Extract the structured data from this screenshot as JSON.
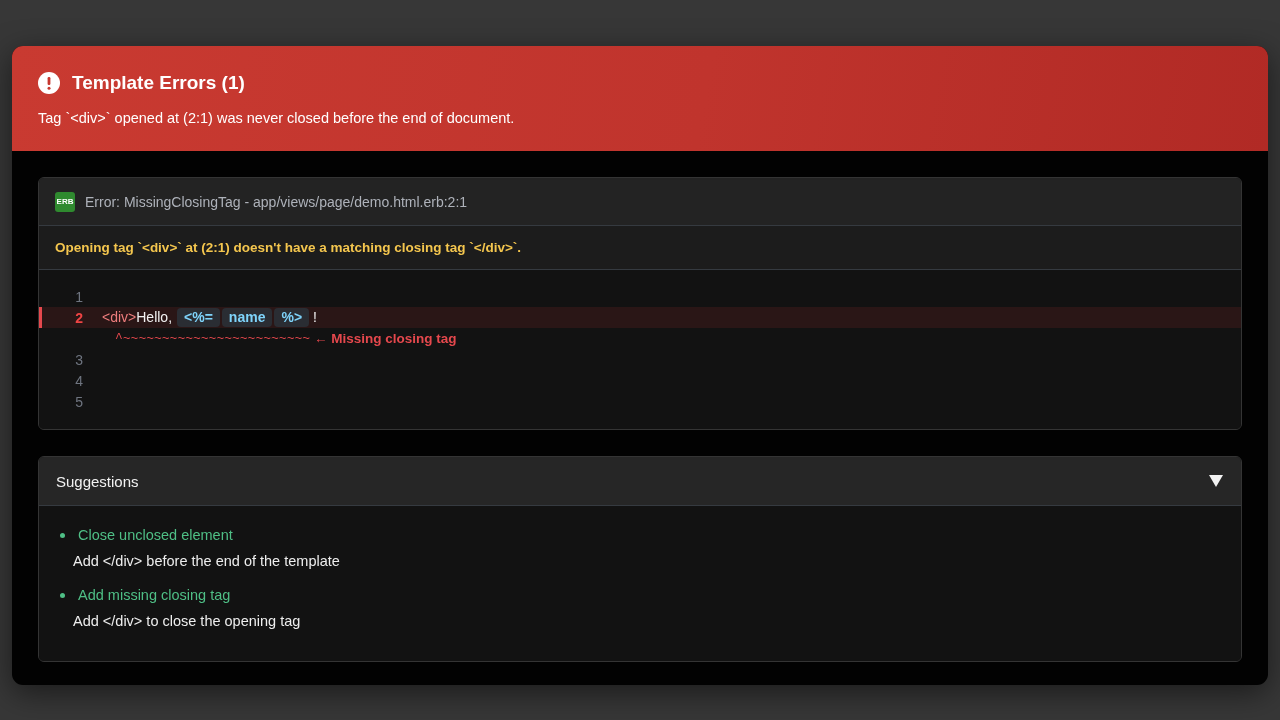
{
  "overlay_header": {
    "title": "Template Errors (1)",
    "message": "Tag `<div>` opened at (2:1) was never closed before the end of document."
  },
  "errors": [
    {
      "badge": "ERB",
      "title": "Error: MissingClosingTag - app/views/page/demo.html.erb:2:1",
      "message": "Opening tag `<div>` at (2:1) doesn't have a matching closing tag `</div>`.",
      "source_lines": [
        {
          "kind": "code",
          "number": "1",
          "highlighted": false
        },
        {
          "kind": "code",
          "number": "2",
          "highlighted": true,
          "tokens": [
            {
              "kind": "tag",
              "text": "<div>"
            },
            {
              "kind": "text",
              "text": "Hello,"
            },
            {
              "kind": "erb",
              "text": "<%="
            },
            {
              "kind": "erb",
              "text": "name"
            },
            {
              "kind": "erb",
              "text": "%>"
            },
            {
              "kind": "text",
              "text": "!"
            }
          ]
        },
        {
          "kind": "pointer",
          "marker": "^~~~~~~~~~~~~~~~~~~~~~~~~",
          "note": "← Missing closing tag"
        },
        {
          "kind": "code",
          "number": "3",
          "highlighted": false
        },
        {
          "kind": "code",
          "number": "4",
          "highlighted": false
        },
        {
          "kind": "code",
          "number": "5",
          "highlighted": false
        }
      ]
    }
  ],
  "suggestions": {
    "title": "Suggestions",
    "expanded": true,
    "items": [
      {
        "title": "Close unclosed element",
        "detail": "Add </div> before the end of the template"
      },
      {
        "title": "Add missing closing tag",
        "detail": "Add </div> to close the opening tag"
      }
    ]
  }
}
